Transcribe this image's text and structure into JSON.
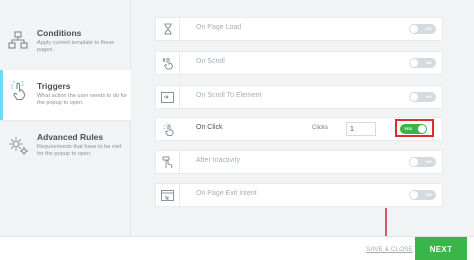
{
  "sidebar": {
    "items": [
      {
        "title": "Conditions",
        "description": "Apply current template to these pages.",
        "icon": "sitemap-icon",
        "active": false
      },
      {
        "title": "Triggers",
        "description": "What action the user needs to do for the popup to open.",
        "icon": "hand-click-icon",
        "active": true
      },
      {
        "title": "Advanced Rules",
        "description": "Requirements that have to be met for the popup to open.",
        "icon": "gears-icon",
        "active": false
      }
    ]
  },
  "triggers": [
    {
      "label": "On Page Load",
      "icon": "hourglass-icon",
      "toggle": "off",
      "toggle_text": "NO"
    },
    {
      "label": "On Scroll",
      "icon": "scroll-hand-icon",
      "toggle": "off",
      "toggle_text": "NO"
    },
    {
      "label": "On Scroll To Element",
      "icon": "scroll-element-icon",
      "toggle": "off",
      "toggle_text": "NO"
    },
    {
      "label": "On Click",
      "icon": "click-icon",
      "toggle": "on",
      "toggle_text": "YES",
      "clicks_label": "Clicks",
      "clicks_value": "1"
    },
    {
      "label": "After Inactivity",
      "icon": "inactivity-icon",
      "toggle": "off",
      "toggle_text": "NO"
    },
    {
      "label": "On Page Exit Intent",
      "icon": "exit-intent-icon",
      "toggle": "off",
      "toggle_text": "NO"
    }
  ],
  "footer": {
    "save_close_label": "SAVE & CLOSE",
    "next_label": "NEXT"
  },
  "colors": {
    "accent_green": "#39b54a",
    "highlight_red": "#e02b2b",
    "active_bar": "#71d7f7"
  }
}
